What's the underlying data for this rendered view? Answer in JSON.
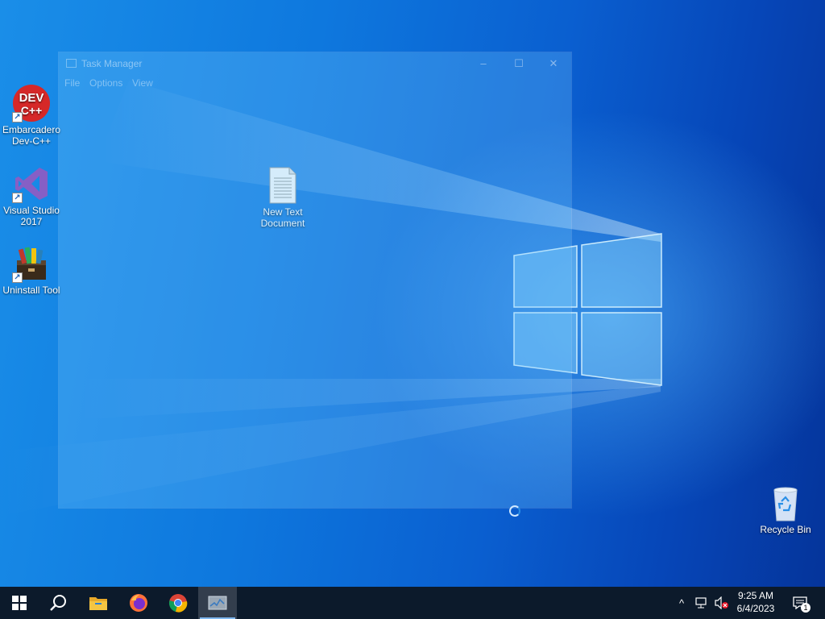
{
  "desktop": {
    "icons": [
      {
        "label_line1": "Embarcadero",
        "label_line2": "Dev-C++",
        "icon": "devcpp-icon",
        "badge_top": "DEV",
        "badge_bottom": "C++"
      },
      {
        "label_line1": "Visual Studio",
        "label_line2": "2017",
        "icon": "visual-studio-icon"
      },
      {
        "label_line1": "Uninstall Tool",
        "label_line2": "",
        "icon": "uninstall-tool-icon"
      },
      {
        "label_line1": "New Text",
        "label_line2": "Document",
        "icon": "text-document-icon"
      },
      {
        "label_line1": "Recycle Bin",
        "label_line2": "",
        "icon": "recycle-bin-icon"
      }
    ]
  },
  "task_manager": {
    "title": "Task Manager",
    "menu": [
      "File",
      "Options",
      "View"
    ],
    "controls": {
      "minimize": "–",
      "maximize": "☐",
      "close": "✕"
    },
    "state": "loading"
  },
  "taskbar": {
    "pinned": [
      "start-icon",
      "search-icon",
      "file-explorer-icon",
      "firefox-icon",
      "chrome-icon",
      "task-manager-icon"
    ],
    "active_app": "task-manager-icon",
    "tray": {
      "chevron": "^",
      "network_icon": "network-icon",
      "volume_icon": "volume-muted-icon"
    },
    "clock": {
      "time": "9:25 AM",
      "date": "6/4/2023"
    },
    "notifications": {
      "count": "1"
    }
  },
  "colors": {
    "taskbar": "#0c1a2b",
    "wallpaper_accent": "#0a5fd0",
    "devcpp_red": "#d62828",
    "vs_purple": "#865fc5",
    "firefox_orange": "#ff7139",
    "folder_yellow": "#f4c542"
  }
}
